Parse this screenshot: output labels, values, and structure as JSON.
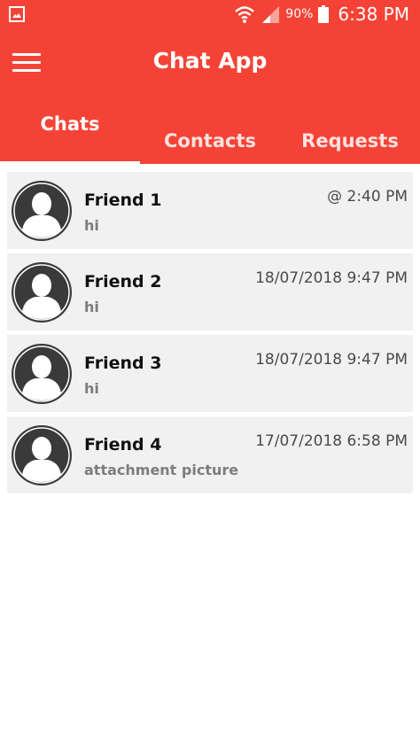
{
  "status_bar": {
    "battery": "90%",
    "time": "6:38 PM"
  },
  "toolbar": {
    "title": "Chat App"
  },
  "tabs": [
    {
      "label": "Chats",
      "active": true
    },
    {
      "label": "Contacts",
      "active": false
    },
    {
      "label": "Requests",
      "active": false
    }
  ],
  "chats": [
    {
      "name": "Friend 1",
      "message": "hi",
      "time": "@ 2:40 PM"
    },
    {
      "name": "Friend 2",
      "message": "hi",
      "time": "18/07/2018 9:47 PM"
    },
    {
      "name": "Friend 3",
      "message": "hi",
      "time": "18/07/2018 9:47 PM"
    },
    {
      "name": "Friend 4",
      "message": "attachment picture",
      "time": "17/07/2018 6:58 PM"
    }
  ],
  "colors": {
    "primary": "#f44336",
    "item_bg": "#f1f1f1",
    "avatar": "#3a3a3a"
  }
}
